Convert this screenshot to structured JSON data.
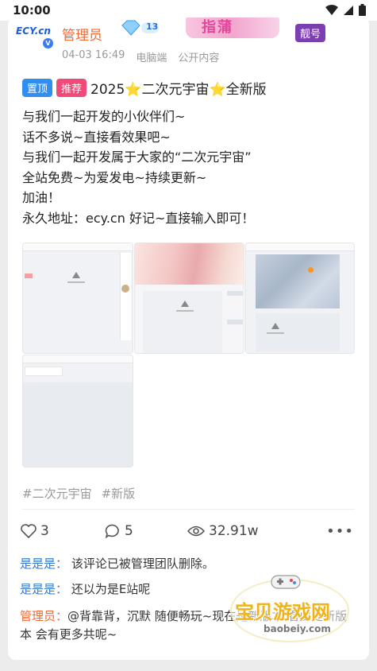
{
  "status_bar": {
    "time": "10:00"
  },
  "post": {
    "author": {
      "name": "管理员",
      "avatar_text": "ECY.cn",
      "level": "13",
      "decoration_text": "指蒲",
      "tag": "靓号"
    },
    "meta": {
      "date": "04-03 16:49",
      "device": "电脑端",
      "visibility": "公开内容"
    },
    "chips": {
      "pinned": "置顶",
      "recommended": "推荐"
    },
    "title": "2025⭐二次元宇宙⭐全新版",
    "body": [
      "与我们一起开发的小伙伴们~",
      "话不多说~直接看效果吧~",
      "与我们一起开发属于大家的“二次元宇宙”",
      "全站免费~为爱发电~持续更新~",
      "加油！",
      "永久地址：ecy.cn 好记~直接输入即可！"
    ],
    "hashtags": [
      "#二次元宇宙",
      "#新版"
    ],
    "stats": {
      "likes": "3",
      "comments": "5",
      "views": "32.91w"
    },
    "colors": {
      "author": "#f06a34",
      "pinned_chip": "#2f8ef0",
      "recommended_chip": "#f04a79",
      "commenter": "#3a7bc8",
      "tag": "#7c3fb2"
    }
  },
  "comments": [
    {
      "user": "是是是",
      "sep": "：",
      "text": "该评论已被管理团队删除。"
    },
    {
      "user": "是是是",
      "sep": "：",
      "text": "还以为是E站呢"
    },
    {
      "user": "管理员",
      "sep": "：",
      "text": "@背靠背，沉默 随便畅玩~现在是新版本 看此处新版本 会有更多共呢~"
    }
  ],
  "watermark": {
    "text": "宝贝游戏网",
    "url": "baobeiy.com"
  }
}
